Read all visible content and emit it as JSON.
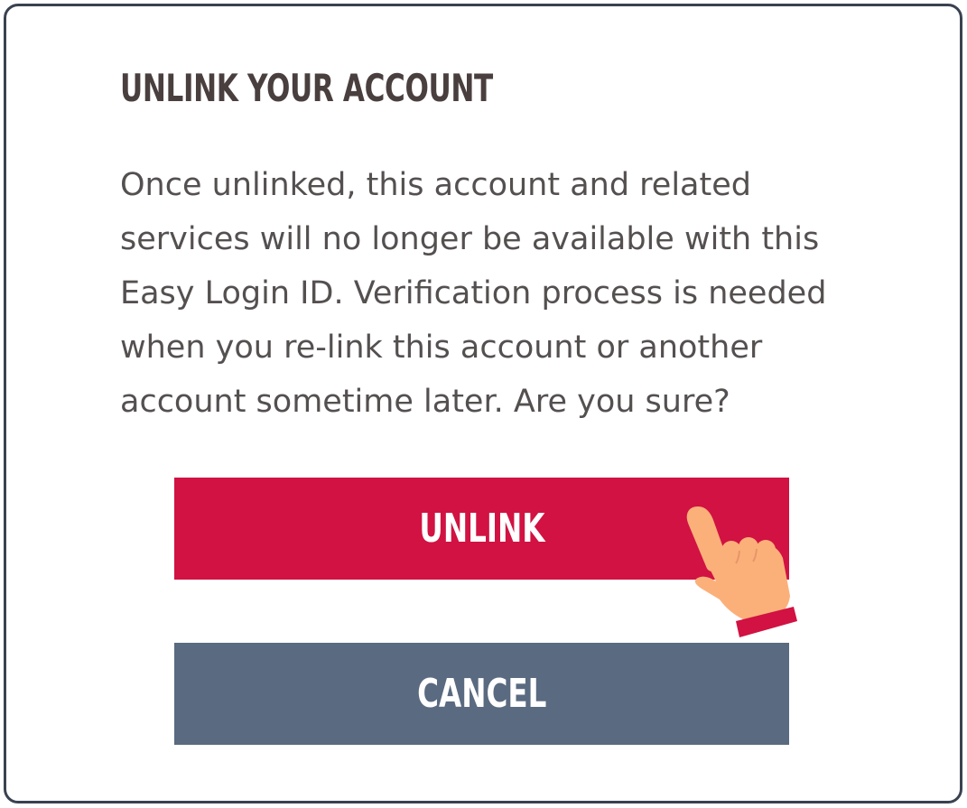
{
  "dialog": {
    "title": "UNLINK YOUR ACCOUNT",
    "message_lines": [
      "Once unlinked, this account and related",
      "services will no longer be available with this",
      "Easy Login ID. Verification process is needed",
      "when you re-link this account or another",
      "account sometime later. Are you sure?"
    ],
    "buttons": {
      "unlink_label": "UNLINK",
      "cancel_label": "CANCEL"
    }
  },
  "colors": {
    "unlink_button": "#d11242",
    "cancel_button": "#5a6a80",
    "title_text": "#4a3f3f",
    "body_text": "#555050",
    "frame_border": "#3a4250",
    "hand_skin": "#fbb07a",
    "hand_cuff": "#d11242"
  },
  "icons": {
    "pointer": "pointing-hand-icon"
  }
}
